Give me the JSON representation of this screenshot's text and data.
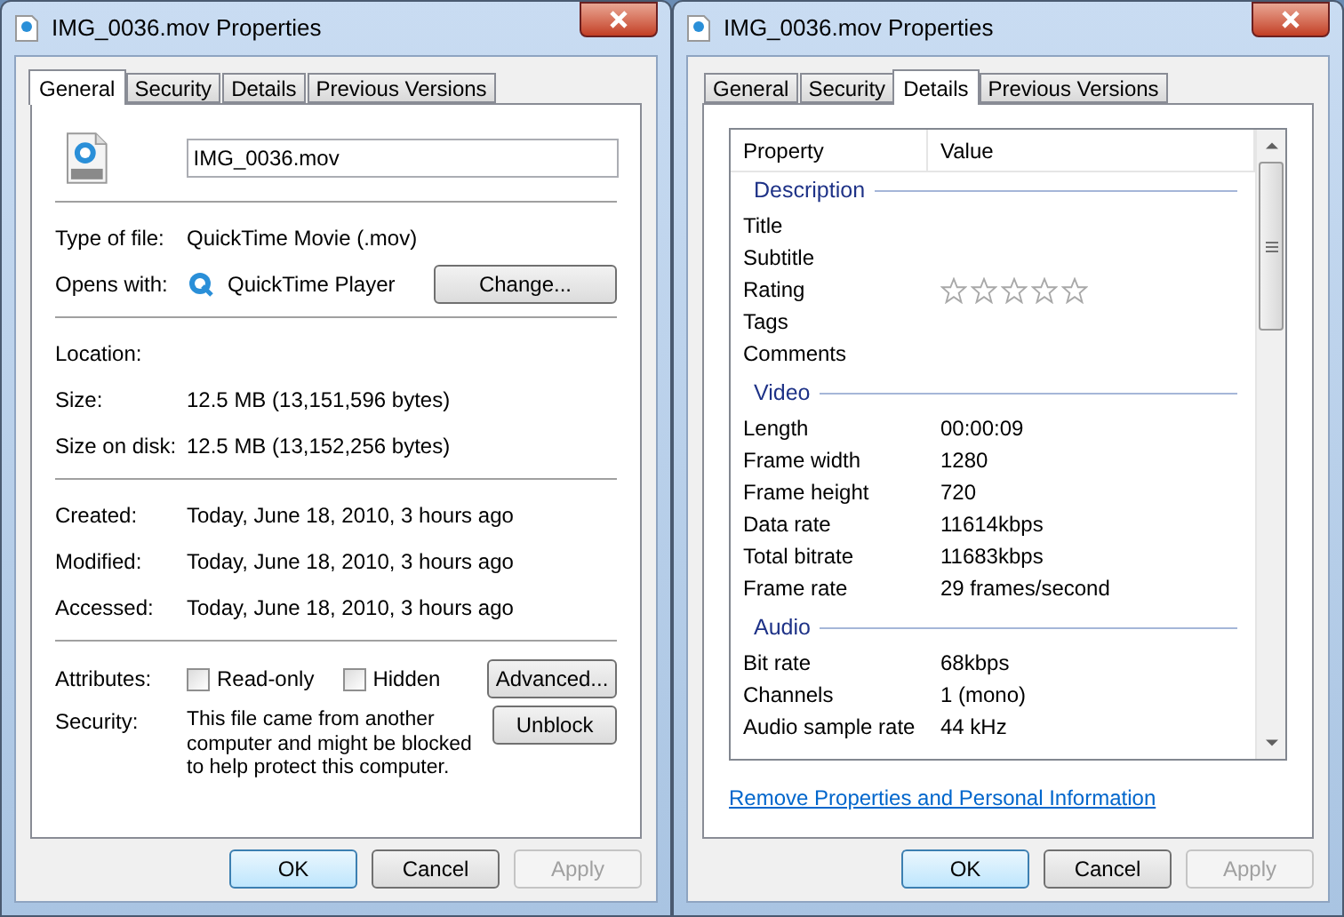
{
  "windows": [
    {
      "title": "IMG_0036.mov Properties",
      "kind": "general",
      "tabs": [
        {
          "label": "General",
          "selected": true
        },
        {
          "label": "Security",
          "selected": false
        },
        {
          "label": "Details",
          "selected": false
        },
        {
          "label": "Previous Versions",
          "selected": false
        }
      ],
      "general": {
        "file_name": "IMG_0036.mov",
        "sections": [
          [
            {
              "label": "Type of file:",
              "value": "QuickTime Movie (.mov)"
            },
            {
              "label": "Opens with:",
              "value": "QuickTime Player",
              "button": "Change..."
            }
          ],
          [
            {
              "label": "Location:"
            },
            {
              "label": "Size:",
              "value": "12.5 MB (13,151,596 bytes)"
            },
            {
              "label": "Size on disk:",
              "value": "12.5 MB (13,152,256 bytes)"
            }
          ],
          [
            {
              "label": "Created:",
              "value": "Today, June 18, 2010, 3 hours ago"
            },
            {
              "label": "Modified:",
              "value": "Today, June 18, 2010, 3 hours ago"
            },
            {
              "label": "Accessed:",
              "value": "Today, June 18, 2010, 3 hours ago"
            }
          ]
        ],
        "attributes": {
          "label": "Attributes:",
          "checkboxes": [
            {
              "label": "Read-only",
              "checked": false
            },
            {
              "label": "Hidden",
              "checked": false
            }
          ],
          "button": "Advanced..."
        },
        "security": {
          "label": "Security:",
          "text": "This file came from another computer and might be blocked to help protect this computer.",
          "button": "Unblock"
        }
      },
      "buttons": [
        {
          "label": "OK",
          "default": true,
          "disabled": false
        },
        {
          "label": "Cancel",
          "default": false,
          "disabled": false
        },
        {
          "label": "Apply",
          "default": false,
          "disabled": true
        }
      ]
    },
    {
      "title": "IMG_0036.mov Properties",
      "kind": "details",
      "tabs": [
        {
          "label": "General",
          "selected": false
        },
        {
          "label": "Security",
          "selected": false
        },
        {
          "label": "Details",
          "selected": true
        },
        {
          "label": "Previous Versions",
          "selected": false
        }
      ],
      "details": {
        "columns": [
          "Property",
          "Value"
        ],
        "groups": [
          {
            "name": "Description",
            "rows": [
              {
                "property": "Title"
              },
              {
                "property": "Subtitle"
              },
              {
                "property": "Rating",
                "stars": 0
              },
              {
                "property": "Tags"
              },
              {
                "property": "Comments"
              }
            ]
          },
          {
            "name": "Video",
            "rows": [
              {
                "property": "Length",
                "value": "00:00:09"
              },
              {
                "property": "Frame width",
                "value": "1280"
              },
              {
                "property": "Frame height",
                "value": "720"
              },
              {
                "property": "Data rate",
                "value": "11614kbps"
              },
              {
                "property": "Total bitrate",
                "value": "11683kbps"
              },
              {
                "property": "Frame rate",
                "value": "29 frames/second"
              }
            ]
          },
          {
            "name": "Audio",
            "rows": [
              {
                "property": "Bit rate",
                "value": "68kbps"
              },
              {
                "property": "Channels",
                "value": "1 (mono)"
              },
              {
                "property": "Audio sample rate",
                "value": "44 kHz"
              }
            ]
          }
        ],
        "link": "Remove Properties and Personal Information"
      },
      "buttons": [
        {
          "label": "OK",
          "default": true,
          "disabled": false
        },
        {
          "label": "Cancel",
          "default": false,
          "disabled": false
        },
        {
          "label": "Apply",
          "default": false,
          "disabled": true
        }
      ]
    }
  ]
}
